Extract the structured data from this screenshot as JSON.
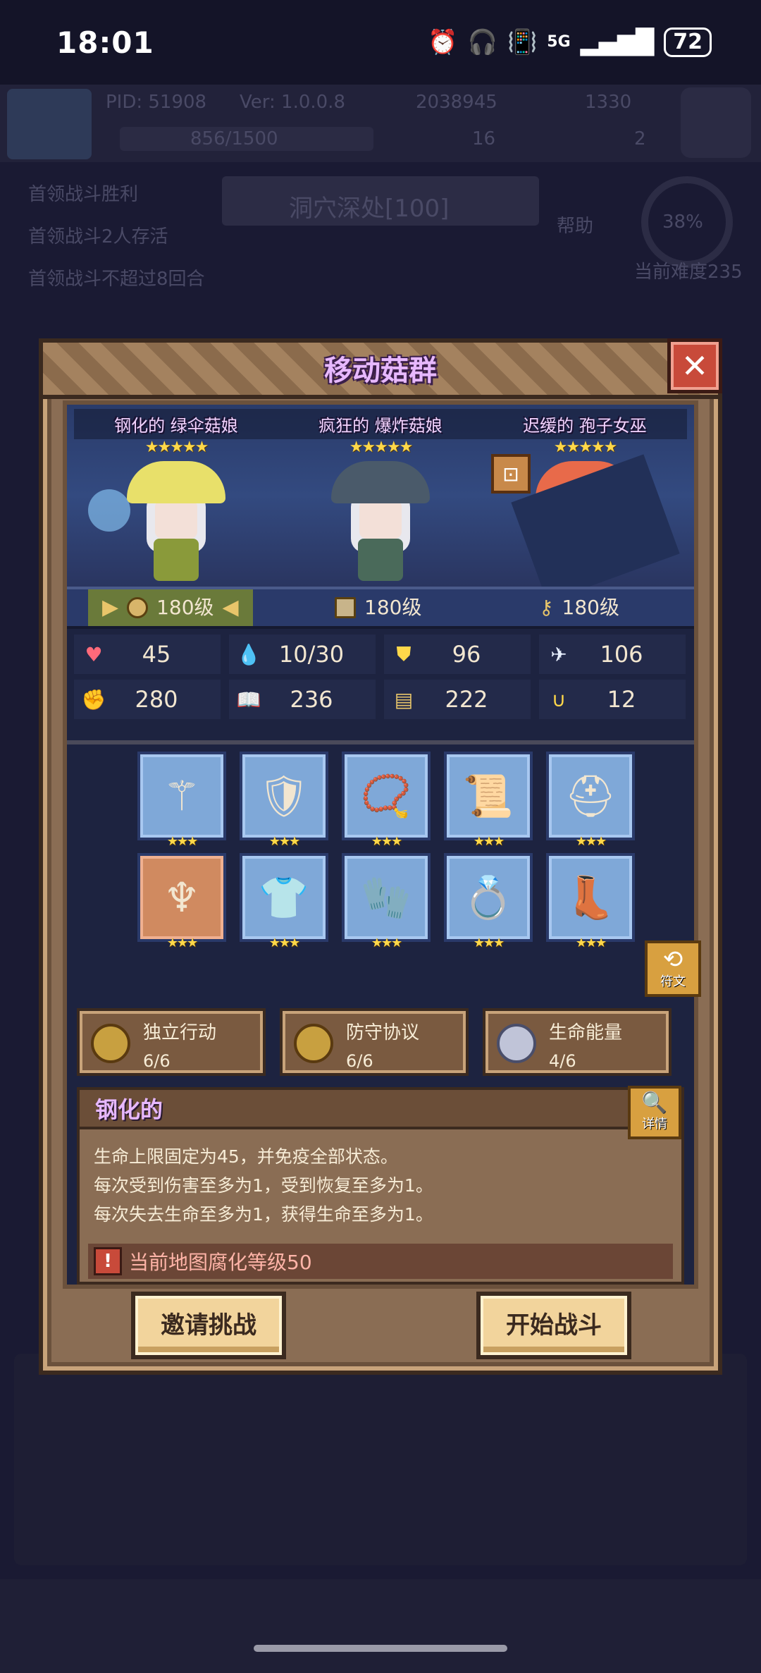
{
  "status_bar": {
    "time": "18:01",
    "network": "5G",
    "battery": "72"
  },
  "background": {
    "pid": "PID: 51908",
    "version": "Ver: 1.0.0.8",
    "gold": "2038945",
    "gems": "1330",
    "exp": "856/1500",
    "clover": "16",
    "key": "2",
    "objectives": [
      "首领战斗胜利",
      "首领战斗2人存活",
      "首领战斗不超过8回合"
    ],
    "stage": "洞穴深处[100]",
    "help": "帮助",
    "progress": "38%",
    "difficulty": "当前难度235"
  },
  "modal": {
    "title": "移动菇群",
    "close_icon": "close-icon",
    "characters": [
      {
        "name": "钢化的 绿伞菇娘",
        "stars": "★★★★★",
        "level": "180级",
        "hat_color": "#e8e06a",
        "body_color": "#8a9a3a"
      },
      {
        "name": "疯狂的 爆炸菇娘",
        "stars": "★★★★★",
        "level": "180级",
        "hat_color": "#4a5a6a",
        "body_color": "#4a6a5a"
      },
      {
        "name": "迟缓的 孢子女巫",
        "stars": "★★★★★",
        "level": "180级",
        "hat_color": "#e86a4a",
        "body_color": "#3a8a5a"
      }
    ],
    "stats": [
      {
        "icon": "heart-icon",
        "glyph": "♥",
        "color": "#ff6a7a",
        "value": "45"
      },
      {
        "icon": "water-drop-icon",
        "glyph": "💧",
        "color": "#6ac8ff",
        "value": "10/30"
      },
      {
        "icon": "shield-icon",
        "glyph": "⛊",
        "color": "#ffd84a",
        "value": "96"
      },
      {
        "icon": "wing-icon",
        "glyph": "✈",
        "color": "#e8f0ff",
        "value": "106"
      },
      {
        "icon": "fist-icon",
        "glyph": "✊",
        "color": "#ffb08a",
        "value": "280"
      },
      {
        "icon": "book-icon",
        "glyph": "📖",
        "color": "#ff8a6a",
        "value": "236"
      },
      {
        "icon": "scroll-icon",
        "glyph": "▤",
        "color": "#e8c56a",
        "value": "222"
      },
      {
        "icon": "horseshoe-icon",
        "glyph": "∪",
        "color": "#ffd84a",
        "value": "12"
      }
    ],
    "equipment": [
      {
        "name": "wand-icon",
        "glyph": "⚚",
        "stars": "★★★"
      },
      {
        "name": "heart-shield-icon",
        "glyph": "🛡",
        "stars": "★★★"
      },
      {
        "name": "necklace-icon",
        "glyph": "📿",
        "stars": "★★★"
      },
      {
        "name": "scroll-item-icon",
        "glyph": "📜",
        "stars": "★★★"
      },
      {
        "name": "helmet-icon",
        "glyph": "⛑",
        "stars": "★★★"
      },
      {
        "name": "horned-helmet-icon",
        "glyph": "♆",
        "stars": "★★★"
      },
      {
        "name": "armor-icon",
        "glyph": "👕",
        "stars": "★★★"
      },
      {
        "name": "gauntlet-icon",
        "glyph": "🧤",
        "stars": "★★★"
      },
      {
        "name": "ring-icon",
        "glyph": "💍",
        "stars": "★★★"
      },
      {
        "name": "boots-icon",
        "glyph": "👢",
        "stars": "★★★"
      }
    ],
    "rune_label": "符文",
    "set_bonuses": [
      {
        "name": "独立行动",
        "count": "6/6"
      },
      {
        "name": "防守协议",
        "count": "6/6"
      },
      {
        "name": "生命能量",
        "count": "4/6"
      }
    ],
    "description": {
      "title": "钢化的",
      "detail_label": "详情",
      "lines": [
        "生命上限固定为45，并免疫全部状态。",
        "每次受到伤害至多为1，受到恢复至多为1。",
        "每次失去生命至多为1，获得生命至多为1。"
      ],
      "warning": "当前地图腐化等级50"
    },
    "buttons": {
      "invite": "邀请挑战",
      "start": "开始战斗"
    }
  }
}
